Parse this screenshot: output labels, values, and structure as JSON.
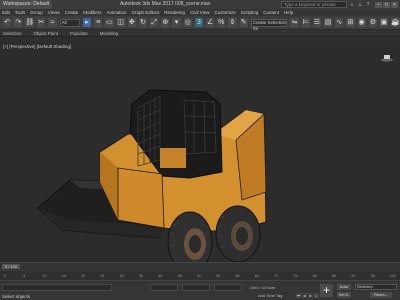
{
  "titlebar": {
    "workspace": "Workspaces: Default",
    "title": "Autodesk 3ds Max 2017    008_scene.max",
    "search_placeholder": "Type a keyword or phrase"
  },
  "menu": [
    "Edit",
    "Tools",
    "Group",
    "Views",
    "Create",
    "Modifiers",
    "Animation",
    "Graph Editors",
    "Rendering",
    "Civil View",
    "Customize",
    "Scripting",
    "Content",
    "Help"
  ],
  "toolbar": {
    "selection_filter": "All",
    "selection_set": "Create Selection Se",
    "snap_value": "3"
  },
  "ribbon": {
    "tabs": [
      "Selection",
      "Object Paint",
      "Populate",
      "Modeling"
    ]
  },
  "viewport": {
    "label": "[+] [Perspective] [Default Shading]"
  },
  "timeline": {
    "slider": "0 / 100",
    "ticks": [
      "0",
      "5",
      "10",
      "15",
      "20",
      "25",
      "30",
      "35",
      "40",
      "45",
      "50",
      "55",
      "60",
      "65",
      "70",
      "75",
      "80",
      "85",
      "90",
      "95",
      "100"
    ]
  },
  "statusbar": {
    "status": "Select objects",
    "grid": "Grid = 10.0cm",
    "add_time_tag": "Add Time Tag",
    "auto": "Auto",
    "set_key": "Set K.",
    "selected": "Selected",
    "filters": "Filters..."
  },
  "colors": {
    "body_orange": "#d3902f",
    "frame_dark": "#1e1e1e",
    "tire": "#2e2e2e"
  }
}
